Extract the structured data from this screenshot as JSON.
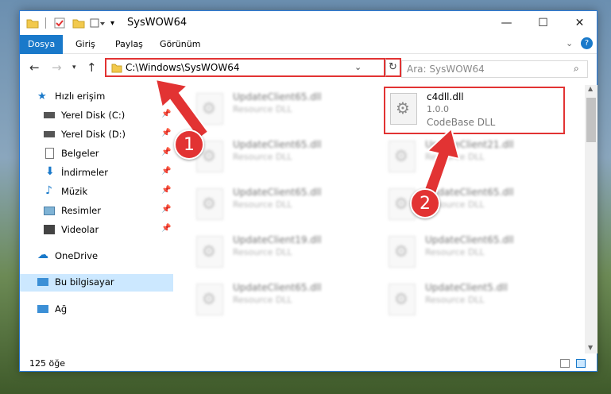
{
  "window": {
    "title": "SysWOW64"
  },
  "ribbon": {
    "tabs": [
      "Dosya",
      "Giriş",
      "Paylaş",
      "Görünüm"
    ]
  },
  "address": {
    "path": "C:\\Windows\\SysWOW64"
  },
  "search": {
    "placeholder": "Ara: SysWOW64"
  },
  "nav": {
    "quick_access": "Hızlı erişim",
    "items": [
      {
        "label": "Yerel Disk (C:)",
        "icon": "drive-icon",
        "pinned": true
      },
      {
        "label": "Yerel Disk (D:)",
        "icon": "drive-icon",
        "pinned": true
      },
      {
        "label": "Belgeler",
        "icon": "documents-icon",
        "pinned": true
      },
      {
        "label": "İndirmeler",
        "icon": "downloads-icon",
        "pinned": true
      },
      {
        "label": "Müzik",
        "icon": "music-icon",
        "pinned": true
      },
      {
        "label": "Resimler",
        "icon": "pictures-icon",
        "pinned": true
      },
      {
        "label": "Videolar",
        "icon": "videos-icon",
        "pinned": true
      }
    ],
    "onedrive": "OneDrive",
    "this_pc": "Bu bilgisayar",
    "network": "Ağ"
  },
  "files": {
    "highlighted": {
      "name": "c4dll.dll",
      "version": "1.0.0",
      "desc": "CodeBase DLL"
    },
    "left_column": [
      {
        "name": "UpdateClient65.dll",
        "desc": "Resource DLL"
      },
      {
        "name": "UpdateClient65.dll",
        "desc": "Resource DLL"
      },
      {
        "name": "UpdateClient65.dll",
        "desc": "Resource DLL"
      },
      {
        "name": "UpdateClient19.dll",
        "desc": "Resource DLL"
      },
      {
        "name": "UpdateClient65.dll",
        "desc": "Resource DLL"
      }
    ],
    "right_column": [
      {
        "name": "UpdateClient21.dll",
        "desc": "Resource DLL"
      },
      {
        "name": "UpdateClient65.dll",
        "desc": "Resource DLL"
      },
      {
        "name": "UpdateClient65.dll",
        "desc": "Resource DLL"
      },
      {
        "name": "UpdateClient5.dll",
        "desc": "Resource DLL"
      }
    ]
  },
  "status": {
    "count": "125 öğe"
  },
  "annotations": {
    "step1": "1",
    "step2": "2"
  },
  "colors": {
    "accent": "#1979ca",
    "annotation": "#e23333"
  }
}
